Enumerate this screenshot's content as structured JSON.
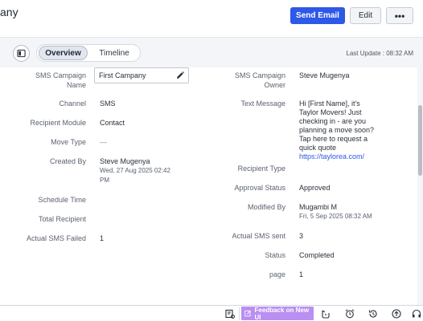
{
  "header": {
    "title_fragment": "any",
    "send_email": "Send Email",
    "edit": "Edit",
    "more": "•••"
  },
  "tabs": {
    "overview": "Overview",
    "timeline": "Timeline",
    "last_update": "Last Update : 08:32 AM"
  },
  "fields": {
    "campaign_name_label": "SMS Campaign Name",
    "campaign_name_label_line1": "SMS Campaign",
    "campaign_name_label_line2": "Name",
    "campaign_name_value": "First Campany",
    "channel_label": "Channel",
    "channel_value": "SMS",
    "recipient_module_label": "Recipient Module",
    "recipient_module_value": "Contact",
    "move_type_label": "Move Type",
    "move_type_value": "—",
    "created_by_label": "Created By",
    "created_by_value": "Steve Mugenya",
    "created_by_time_line1": "Wed, 27 Aug 2025 02:42",
    "created_by_time_line2": "PM",
    "schedule_time_label": "Schedule Time",
    "total_recipient_label": "Total Recipient",
    "actual_sms_failed_label": "Actual SMS Failed",
    "actual_sms_failed_value": "1",
    "campaign_owner_label_line1": "SMS Campaign",
    "campaign_owner_label_line2": "Owner",
    "campaign_owner_value": "Steve Mugenya",
    "text_message_label": "Text Message",
    "text_message_line1": "Hi [First Name], it's",
    "text_message_line2": "Taylor Movers! Just",
    "text_message_line3": "checking in - are you",
    "text_message_line4": "planning a move soon?",
    "text_message_line5": "Tap here to request a",
    "text_message_line6": "quick quote",
    "text_message_link": "https://taylorea.com/",
    "recipient_type_label": "Recipient Type",
    "approval_status_label": "Approval Status",
    "approval_status_value": "Approved",
    "modified_by_label": "Modified By",
    "modified_by_value": "Mugambi M",
    "modified_by_time": "Fri, 5 Sep 2025 08:32 AM",
    "actual_sms_sent_label": "Actual SMS sent",
    "actual_sms_sent_value": "3",
    "status_label": "Status",
    "status_value": "Completed",
    "page_label": "page",
    "page_value": "1"
  },
  "bottombar": {
    "feedback": "Feedback on New UI"
  },
  "colors": {
    "primary": "#2d58e8",
    "feedback_bg": "#b98ff2",
    "tabstrip_bg": "#f4f5f8"
  },
  "icons": [
    "sidebar-toggle-icon",
    "pencil-icon",
    "layout-icon",
    "edit-feedback-icon",
    "bot-icon",
    "alarm-icon",
    "history-icon",
    "upload-icon",
    "headphone-icon"
  ]
}
